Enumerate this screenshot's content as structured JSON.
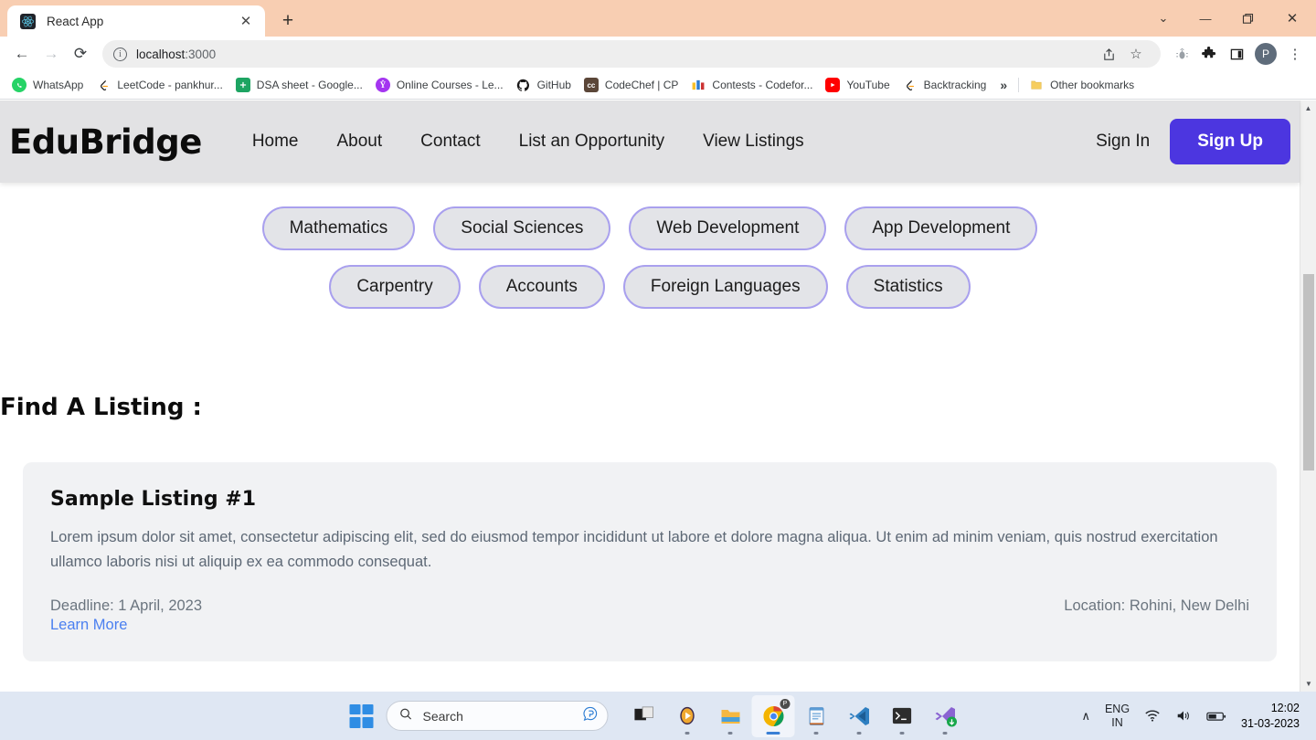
{
  "browser": {
    "tab": {
      "title": "React App",
      "favicon": "react-icon",
      "close": "✕"
    },
    "newtab": "+",
    "window_controls": {
      "minimize_tabs": "⌄",
      "minimize": "—",
      "maximize": "❐",
      "close": "✕"
    },
    "toolbar": {
      "back": "←",
      "forward": "→",
      "reload": "⟳",
      "info_icon": "i",
      "url": "localhost",
      "url_port": ":3000",
      "share_icon": "↱",
      "bookmark_icon": "☆",
      "bug_icon": "🐞",
      "extensions_icon": "🧩",
      "sidepanel_icon": "◱",
      "profile_initial": "P",
      "menu_icon": "⋮"
    },
    "bookmarks": [
      {
        "label": "WhatsApp",
        "icon": "whatsapp-icon",
        "color": "#25d366",
        "glyph": "✆"
      },
      {
        "label": "LeetCode - pankhur...",
        "icon": "leetcode-icon",
        "color": "#ffffff",
        "glyph": "⬡"
      },
      {
        "label": "DSA sheet - Google...",
        "icon": "google-sheets-icon",
        "color": "#1da462",
        "glyph": "✚"
      },
      {
        "label": "Online Courses - Le...",
        "icon": "udemy-icon",
        "color": "#a435f0",
        "glyph": "Û"
      },
      {
        "label": "GitHub",
        "icon": "github-icon",
        "color": "#181717",
        "glyph": "●"
      },
      {
        "label": "CodeChef | CP",
        "icon": "codechef-icon",
        "color": "#5b4638",
        "glyph": "cc"
      },
      {
        "label": "Contests - Codefor...",
        "icon": "codeforces-icon",
        "color": "#ffffff",
        "glyph": "▐"
      },
      {
        "label": "YouTube",
        "icon": "youtube-icon",
        "color": "#ff0000",
        "glyph": "▶"
      },
      {
        "label": "Backtracking",
        "icon": "leetcode-icon",
        "color": "#ffffff",
        "glyph": "⬡"
      }
    ],
    "bookmarks_overflow": "»",
    "other_bookmarks": {
      "label": "Other bookmarks",
      "icon": "folder-icon"
    }
  },
  "site": {
    "brand": "EduBridge",
    "nav_links": [
      {
        "label": "Home"
      },
      {
        "label": "About"
      },
      {
        "label": "Contact"
      },
      {
        "label": "List an Opportunity"
      },
      {
        "label": "View Listings"
      }
    ],
    "sign_in": "Sign In",
    "sign_up": "Sign Up",
    "accent_color": "#4c36e0",
    "navbar_bg": "#e2e2e4",
    "categories_row1": [
      {
        "label": "Mathematics"
      },
      {
        "label": "Social Sciences"
      },
      {
        "label": "Web Development"
      },
      {
        "label": "App Development"
      }
    ],
    "categories_row2": [
      {
        "label": "Carpentry"
      },
      {
        "label": "Accounts"
      },
      {
        "label": "Foreign Languages"
      },
      {
        "label": "Statistics"
      }
    ],
    "section_title": "Find A Listing :",
    "listing": {
      "title": "Sample Listing #1",
      "description": "Lorem ipsum dolor sit amet, consectetur adipiscing elit, sed do eiusmod tempor incididunt ut labore et dolore magna aliqua. Ut enim ad minim veniam, quis nostrud exercitation ullamco laboris nisi ut aliquip ex ea commodo consequat.",
      "deadline": "Deadline: 1 April, 2023",
      "location": "Location: Rohini, New Delhi",
      "learn_more": "Learn More",
      "link_color": "#4a7ff0"
    }
  },
  "taskbar": {
    "start": "start-button",
    "search_placeholder": "Search",
    "search_icon": "🔍",
    "copilot_icon": "b",
    "apps": [
      {
        "name": "task-view",
        "glyph": "◰"
      },
      {
        "name": "media-player",
        "glyph": "▶"
      },
      {
        "name": "file-explorer",
        "glyph": "📁"
      },
      {
        "name": "google-chrome",
        "glyph": "◉"
      },
      {
        "name": "notepad",
        "glyph": "📝"
      },
      {
        "name": "vs-code",
        "glyph": "✕"
      },
      {
        "name": "terminal",
        "glyph": "⌫"
      },
      {
        "name": "visual-studio",
        "glyph": "∞"
      }
    ],
    "tray": {
      "chevron": "∧",
      "language": "ENG",
      "language_region": "IN",
      "wifi_icon": "◠",
      "volume_icon": "🔊",
      "battery_icon": "▭",
      "time": "12:02",
      "date": "31-03-2023"
    }
  }
}
